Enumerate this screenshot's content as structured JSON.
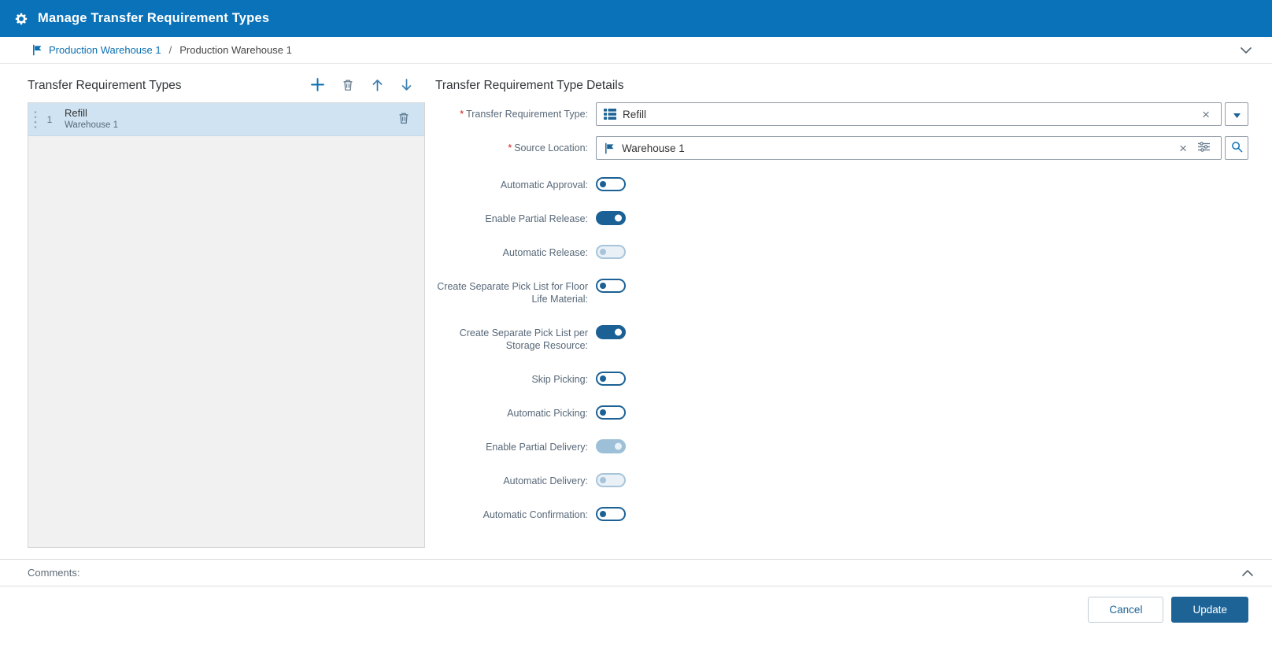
{
  "ui": {
    "required_marker": "*"
  },
  "titlebar": {
    "title": "Manage Transfer Requirement Types",
    "icon": "gear-icon"
  },
  "breadcrumb": {
    "link": "Production Warehouse 1",
    "separator": "/",
    "current": "Production Warehouse 1",
    "icon": "warehouse-flag-icon"
  },
  "left_panel": {
    "title": "Transfer Requirement Types",
    "toolbar": [
      "add-icon",
      "delete-icon",
      "move-up-icon",
      "move-down-icon"
    ],
    "items": [
      {
        "index": "1",
        "name": "Refill",
        "subtitle": "Warehouse 1",
        "selected": true
      }
    ]
  },
  "details": {
    "title": "Transfer Requirement Type Details",
    "fields": [
      {
        "label": "Transfer Requirement Type:",
        "required": true,
        "value": "Refill",
        "control": "dropdown",
        "icon": "list-icon"
      },
      {
        "label": "Source Location:",
        "required": true,
        "value": "Warehouse 1",
        "control": "search",
        "icon": "warehouse-flag-icon"
      }
    ],
    "toggles": [
      {
        "label": "Automatic Approval:",
        "state": "off",
        "disabled": false
      },
      {
        "label": "Enable Partial Release:",
        "state": "on",
        "disabled": false
      },
      {
        "label": "Automatic Release:",
        "state": "off",
        "disabled": true
      },
      {
        "label": "Create Separate Pick List for Floor Life Material:",
        "state": "off",
        "disabled": false
      },
      {
        "label": "Create Separate Pick List per Storage Resource:",
        "state": "on",
        "disabled": false
      },
      {
        "label": "Skip Picking:",
        "state": "off",
        "disabled": false
      },
      {
        "label": "Automatic Picking:",
        "state": "off",
        "disabled": false
      },
      {
        "label": "Enable Partial Delivery:",
        "state": "on",
        "disabled": true
      },
      {
        "label": "Automatic Delivery:",
        "state": "off",
        "disabled": true
      },
      {
        "label": "Automatic Confirmation:",
        "state": "off",
        "disabled": false
      }
    ]
  },
  "comments": {
    "label": "Comments:"
  },
  "footer": {
    "cancel_label": "Cancel",
    "update_label": "Update"
  },
  "colors": {
    "header_blue": "#0a72b8",
    "accent_blue": "#0a6fb0",
    "toggle_on": "#1b6196",
    "primary_button": "#1d6396",
    "selected_row": "#cfe3f3"
  }
}
